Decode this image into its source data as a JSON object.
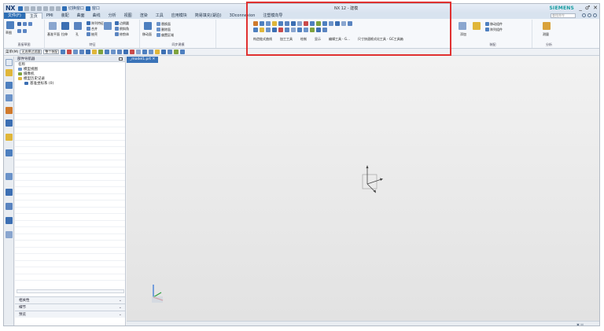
{
  "app": {
    "logo": "NX",
    "quick_access_label": "切换窗口",
    "window_menu": "窗口",
    "title": "NX 12 - 建模",
    "brand": "SIEMENS",
    "window_controls": [
      "_",
      "♂",
      "✕"
    ]
  },
  "tabs": [
    {
      "label": "文件(F)",
      "kind": "file"
    },
    {
      "label": "主页",
      "kind": "active"
    },
    {
      "label": "PMI",
      "kind": "normal"
    },
    {
      "label": "装配",
      "kind": "normal"
    },
    {
      "label": "曲面",
      "kind": "normal"
    },
    {
      "label": "曲线",
      "kind": "normal"
    },
    {
      "label": "分析",
      "kind": "normal"
    },
    {
      "label": "视图",
      "kind": "normal"
    },
    {
      "label": "渲染",
      "kind": "normal"
    },
    {
      "label": "工具",
      "kind": "normal"
    },
    {
      "label": "应用模块",
      "kind": "normal"
    },
    {
      "label": "简易填充(湖泊)",
      "kind": "normal"
    },
    {
      "label": "3Dconnexion",
      "kind": "normal"
    },
    {
      "label": "注塑模向导",
      "kind": "normal"
    }
  ],
  "command_search_placeholder": "查找命令",
  "ribbon": {
    "sketch_group": {
      "label": "直接草图",
      "buttons": [
        "草图",
        "拉伸",
        "孔"
      ]
    },
    "feature_group": {
      "label": "特征",
      "items": [
        "基准平面",
        "拉伸",
        "孔",
        "阵列特征",
        "合并",
        "抽壳",
        "拔模",
        "边倒圆",
        "倒斜角",
        "修剪体",
        "拆分体",
        "更多"
      ]
    },
    "sync_group": {
      "label": "同步建模",
      "items": [
        "移动面",
        "替换面",
        "删除面",
        "偏置区域",
        "更多"
      ]
    },
    "highlight_groups": [
      "构造链式曲线",
      "加工工具",
      "绘制",
      "显示",
      "编辑工具 - G...",
      "尺寸快速格式化工具 - GC工具箱"
    ],
    "assembly_group": {
      "label": "装配",
      "items": [
        "添加",
        "装配约束",
        "移动组件",
        "阵列组件",
        "菜单"
      ]
    },
    "analysis_group": {
      "label": "分析",
      "items": [
        "测量"
      ]
    }
  },
  "toolbar2": {
    "menu_label": "菜单(M)",
    "filter_select": "无选择过滤器",
    "scope_select": "整个装配"
  },
  "navigator": {
    "title": "部件导航器",
    "column_name": "名称",
    "tree": [
      {
        "label": "模型视图",
        "indent": 1
      },
      {
        "label": "摄像机",
        "indent": 1
      },
      {
        "label": "模型历史记录",
        "indent": 1
      },
      {
        "label": "基准坐标系 (0)",
        "indent": 2
      }
    ],
    "panels": [
      "相关性",
      "细节",
      "预览"
    ]
  },
  "graphics_tab": {
    "label": "_model1.prt ✕"
  },
  "colors": {
    "file_tab": "#2e6fb5",
    "highlight_box": "#e03131",
    "brand": "#129a9e"
  }
}
